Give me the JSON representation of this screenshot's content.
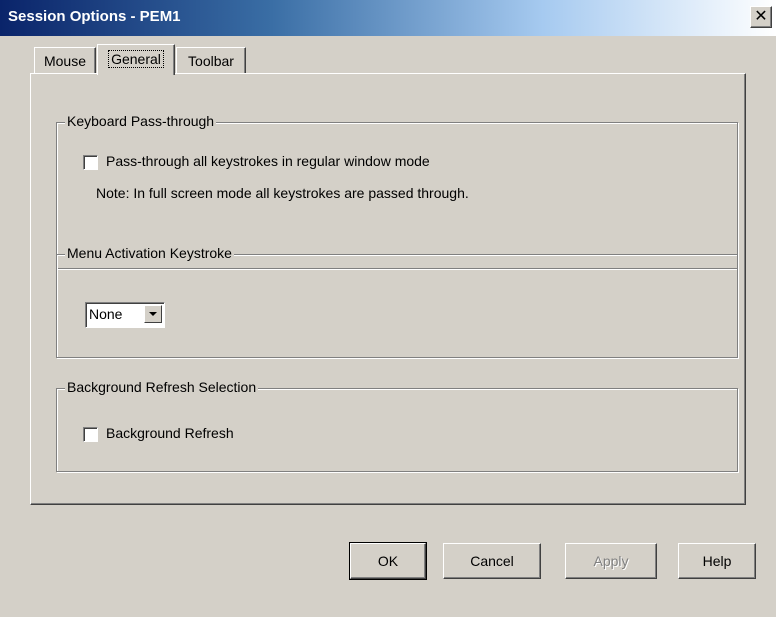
{
  "window": {
    "title": "Session Options - PEM1",
    "close_glyph": "✕"
  },
  "tabs": [
    {
      "label": "Mouse",
      "active": false
    },
    {
      "label": "General",
      "active": true
    },
    {
      "label": "Toolbar",
      "active": false
    }
  ],
  "keyboard_group": {
    "legend": "Keyboard Pass-through",
    "checkbox_label": "Pass-through all keystrokes in regular window mode",
    "checked": false,
    "note": "Note: In full screen mode all keystrokes are passed through."
  },
  "menu_group": {
    "legend": "Menu Activation Keystroke",
    "selected_value": "None"
  },
  "refresh_group": {
    "legend": "Background Refresh Selection",
    "checkbox_label": "Background Refresh",
    "checked": false
  },
  "buttons": {
    "ok": "OK",
    "cancel": "Cancel",
    "apply": "Apply",
    "help": "Help"
  },
  "colors": {
    "face": "#d4d0c8",
    "title_start": "#0a246a",
    "title_end": "#ffffff"
  }
}
